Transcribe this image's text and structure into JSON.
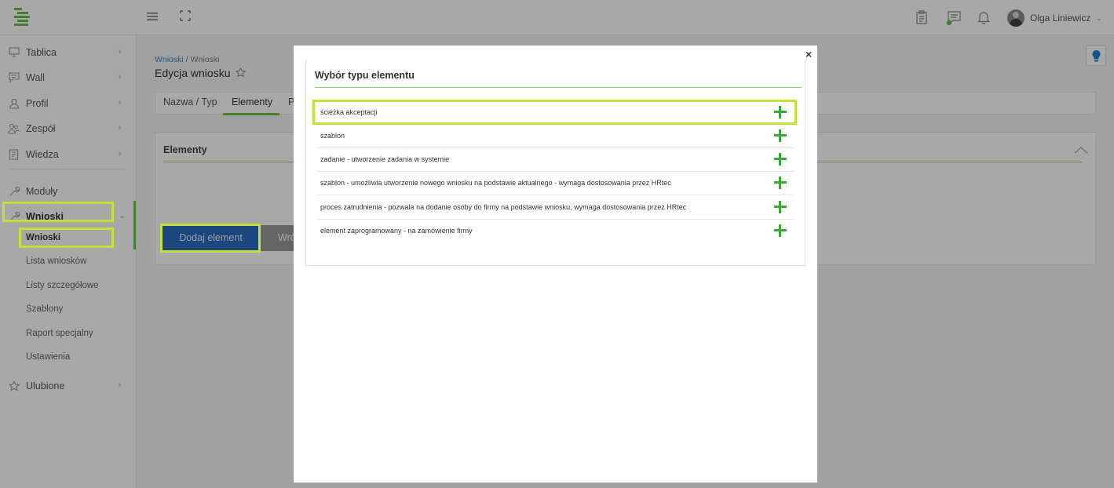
{
  "header": {
    "user_name": "Olga Liniewicz"
  },
  "sidebar": {
    "items": [
      {
        "label": "Tablica",
        "icon": "monitor-icon"
      },
      {
        "label": "Wall",
        "icon": "chat-icon"
      },
      {
        "label": "Profil",
        "icon": "user-icon"
      },
      {
        "label": "Zespół",
        "icon": "team-icon"
      },
      {
        "label": "Wiedza",
        "icon": "book-icon"
      },
      {
        "label": "Moduły",
        "icon": "wrench-icon"
      },
      {
        "label": "Wnioski",
        "icon": "wrench-icon"
      },
      {
        "label": "Ulubione",
        "icon": "star-icon"
      }
    ],
    "subitems": [
      "Wnioski",
      "Lista wniosków",
      "Listy szczegółowe",
      "Szablony",
      "Raport specjalny",
      "Ustawienia"
    ]
  },
  "breadcrumb": {
    "link": "Wnioski",
    "sep": " / ",
    "current": "Wnioski"
  },
  "page": {
    "title": "Edycja wniosku"
  },
  "tabs": [
    "Nazwa / Typ",
    "Elementy",
    "P"
  ],
  "panel": {
    "title": "Elementy",
    "add_button": "Dodaj element",
    "back_button": "Wró"
  },
  "modal": {
    "close": "×",
    "title": "Wybór typu elementu",
    "options": [
      "ścieżka akceptacji",
      "szablon",
      "zadanie - utworzenie zadania w systemie",
      "szablon - umożliwia utworzenie nowego wniosku na podstawie aktualnego - wymaga dostosowania przez HRtec",
      "proces zatrudnienia - pozwala na dodanie osoby do firmy na podstawie wniosku, wymaga dostosowania przez HRtec",
      "element zaprogramowany - na zamówienie firmy"
    ]
  },
  "colors": {
    "accent_green": "#6abf4b",
    "highlight": "#c0e23a",
    "primary_button": "#2b6cc0",
    "help_icon": "#1a7fd6"
  }
}
